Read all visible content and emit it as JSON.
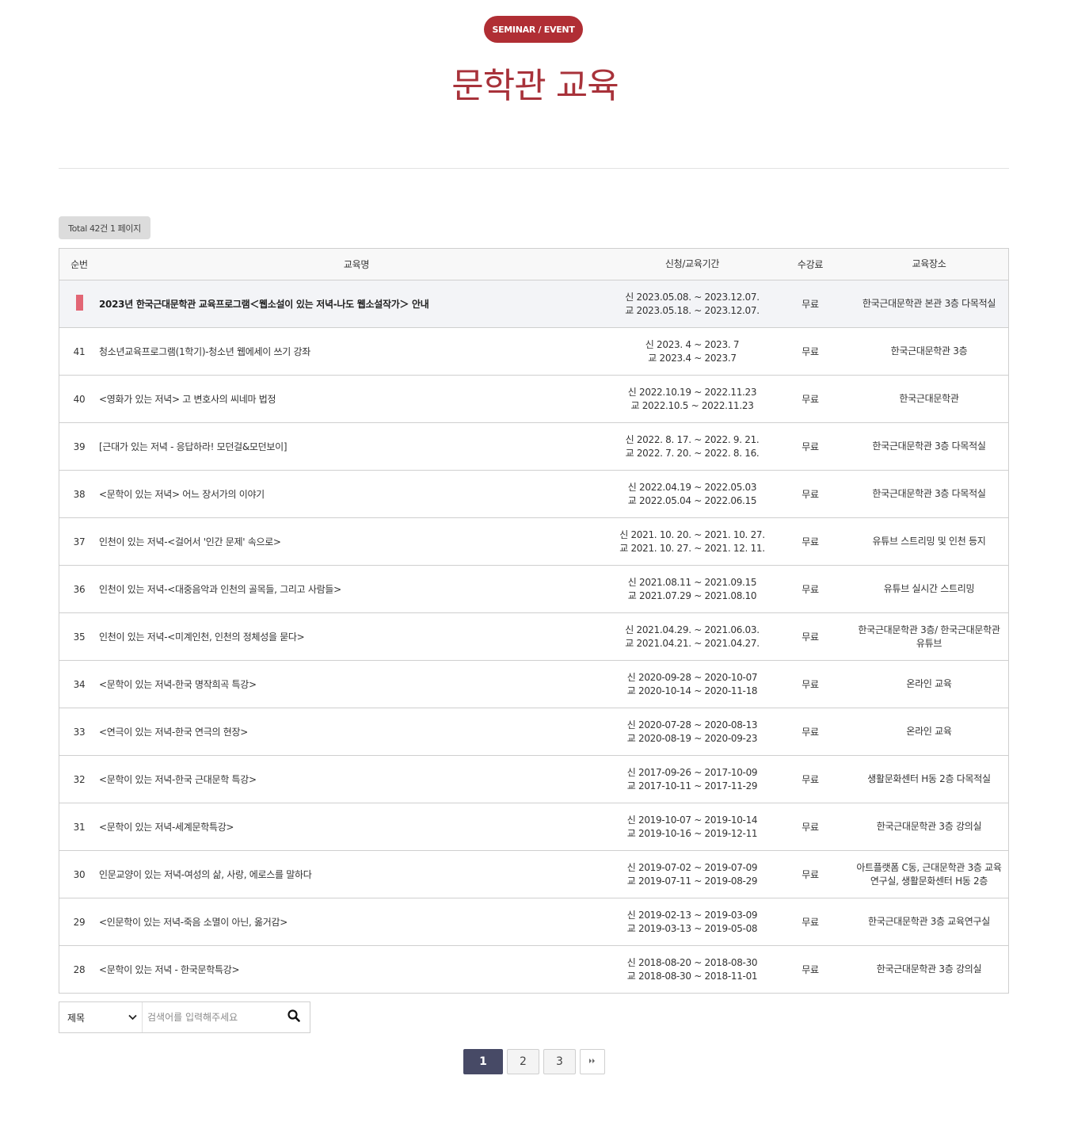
{
  "header": {
    "badge": "SEMINAR / EVENT",
    "title": "문학관 교육"
  },
  "summary": {
    "total_text": "Total 42건 1 페이지"
  },
  "table": {
    "columns": {
      "num": "순번",
      "title": "교육명",
      "period": "신청/교육기간",
      "fee": "수강료",
      "place": "교육장소"
    },
    "notice": {
      "title": "2023년 한국근대문학관 교육프로그램＜웹소설이 있는 저녁-나도 웹소설작가＞ 안내",
      "apply": "신 2023.05.08. ~ 2023.12.07.",
      "edu": "교 2023.05.18. ~ 2023.12.07.",
      "fee": "무료",
      "place": "한국근대문학관 본관 3층 다목적실"
    },
    "rows": [
      {
        "num": "41",
        "title": "청소년교육프로그램(1학기)-청소년 웹에세이 쓰기 강좌",
        "apply": "신 2023. 4 ~ 2023. 7",
        "edu": "교 2023.4 ~ 2023.7",
        "fee": "무료",
        "place": "한국근대문학관 3층"
      },
      {
        "num": "40",
        "title": "<영화가 있는 저녁> 고 변호사의 씨네마 법정",
        "apply": "신 2022.10.19 ~ 2022.11.23",
        "edu": "교 2022.10.5 ~ 2022.11.23",
        "fee": "무료",
        "place": "한국근대문학관"
      },
      {
        "num": "39",
        "title": "[근대가 있는 저녁 - 응답하라! 모던걸&모던보이]",
        "apply": "신 2022. 8. 17. ~ 2022. 9. 21.",
        "edu": "교 2022. 7. 20. ~ 2022. 8. 16.",
        "fee": "무료",
        "place": "한국근대문학관 3층 다목적실"
      },
      {
        "num": "38",
        "title": "<문학이 있는 저녁> 어느 장서가의 이야기",
        "apply": "신 2022.04.19 ~ 2022.05.03",
        "edu": "교 2022.05.04 ~ 2022.06.15",
        "fee": "무료",
        "place": "한국근대문학관 3층 다목적실"
      },
      {
        "num": "37",
        "title": "인천이 있는 저녁-<걸어서 '인간 문제' 속으로>",
        "apply": "신 2021. 10. 20. ~ 2021. 10. 27.",
        "edu": "교 2021. 10. 27. ~ 2021. 12. 11.",
        "fee": "무료",
        "place": "유튜브 스트리밍 및 인천 등지"
      },
      {
        "num": "36",
        "title": "인천이 있는 저녁-<대중음악과 인천의 골목들, 그리고 사람들>",
        "apply": "신 2021.08.11 ~ 2021.09.15",
        "edu": "교 2021.07.29 ~ 2021.08.10",
        "fee": "무료",
        "place": "유튜브 실시간 스트리밍"
      },
      {
        "num": "35",
        "title": "인천이 있는 저녁-<미계인천, 인천의 정체성을 묻다>",
        "apply": "신 2021.04.29. ~ 2021.06.03.",
        "edu": "교 2021.04.21. ~ 2021.04.27.",
        "fee": "무료",
        "place": "한국근대문학관 3층/ 한국근대문학관 유튜브"
      },
      {
        "num": "34",
        "title": "<문학이 있는 저녁-한국 명작희곡 특강>",
        "apply": "신 2020-09-28 ~ 2020-10-07",
        "edu": "교 2020-10-14 ~ 2020-11-18",
        "fee": "무료",
        "place": "온라인 교육"
      },
      {
        "num": "33",
        "title": "<연극이 있는 저녁-한국 연극의 현장>",
        "apply": "신 2020-07-28 ~ 2020-08-13",
        "edu": "교 2020-08-19 ~ 2020-09-23",
        "fee": "무료",
        "place": "온라인 교육"
      },
      {
        "num": "32",
        "title": "<문학이 있는 저녁-한국 근대문학 특강>",
        "apply": "신 2017-09-26 ~ 2017-10-09",
        "edu": "교 2017-10-11 ~ 2017-11-29",
        "fee": "무료",
        "place": "생활문화센터 H동 2층 다목적실"
      },
      {
        "num": "31",
        "title": "<문학이 있는 저녁-세계문학특강>",
        "apply": "신 2019-10-07 ~ 2019-10-14",
        "edu": "교 2019-10-16 ~ 2019-12-11",
        "fee": "무료",
        "place": "한국근대문학관 3층 강의실"
      },
      {
        "num": "30",
        "title": "인문교양이 있는 저녁-여성의 삶, 사랑, 에로스를 말하다",
        "apply": "신 2019-07-02 ~ 2019-07-09",
        "edu": "교 2019-07-11 ~ 2019-08-29",
        "fee": "무료",
        "place": "아트플랫폼 C동, 근대문학관 3층 교육연구실, 생활문화센터 H동 2층"
      },
      {
        "num": "29",
        "title": "<인문학이 있는 저녁-죽음 소멸이 아닌, 옮거감>",
        "apply": "신 2019-02-13 ~ 2019-03-09",
        "edu": "교 2019-03-13 ~ 2019-05-08",
        "fee": "무료",
        "place": "한국근대문학관 3층 교육연구실"
      },
      {
        "num": "28",
        "title": "<문학이 있는 저녁 - 한국문학특강>",
        "apply": "신 2018-08-20 ~ 2018-08-30",
        "edu": "교 2018-08-30 ~ 2018-11-01",
        "fee": "무료",
        "place": "한국근대문학관 3층 강의실"
      }
    ]
  },
  "search": {
    "select_value": "제목",
    "placeholder": "검색어를 입력해주세요",
    "icon": "search-icon"
  },
  "pagination": {
    "pages": [
      "1",
      "2",
      "3"
    ],
    "current": "1",
    "next_icon": "double-chevron-right-icon"
  },
  "colors": {
    "accent": "#b02e34",
    "title": "#a8323a",
    "notice_mark": "#e26675",
    "pager_active": "#474a66"
  }
}
